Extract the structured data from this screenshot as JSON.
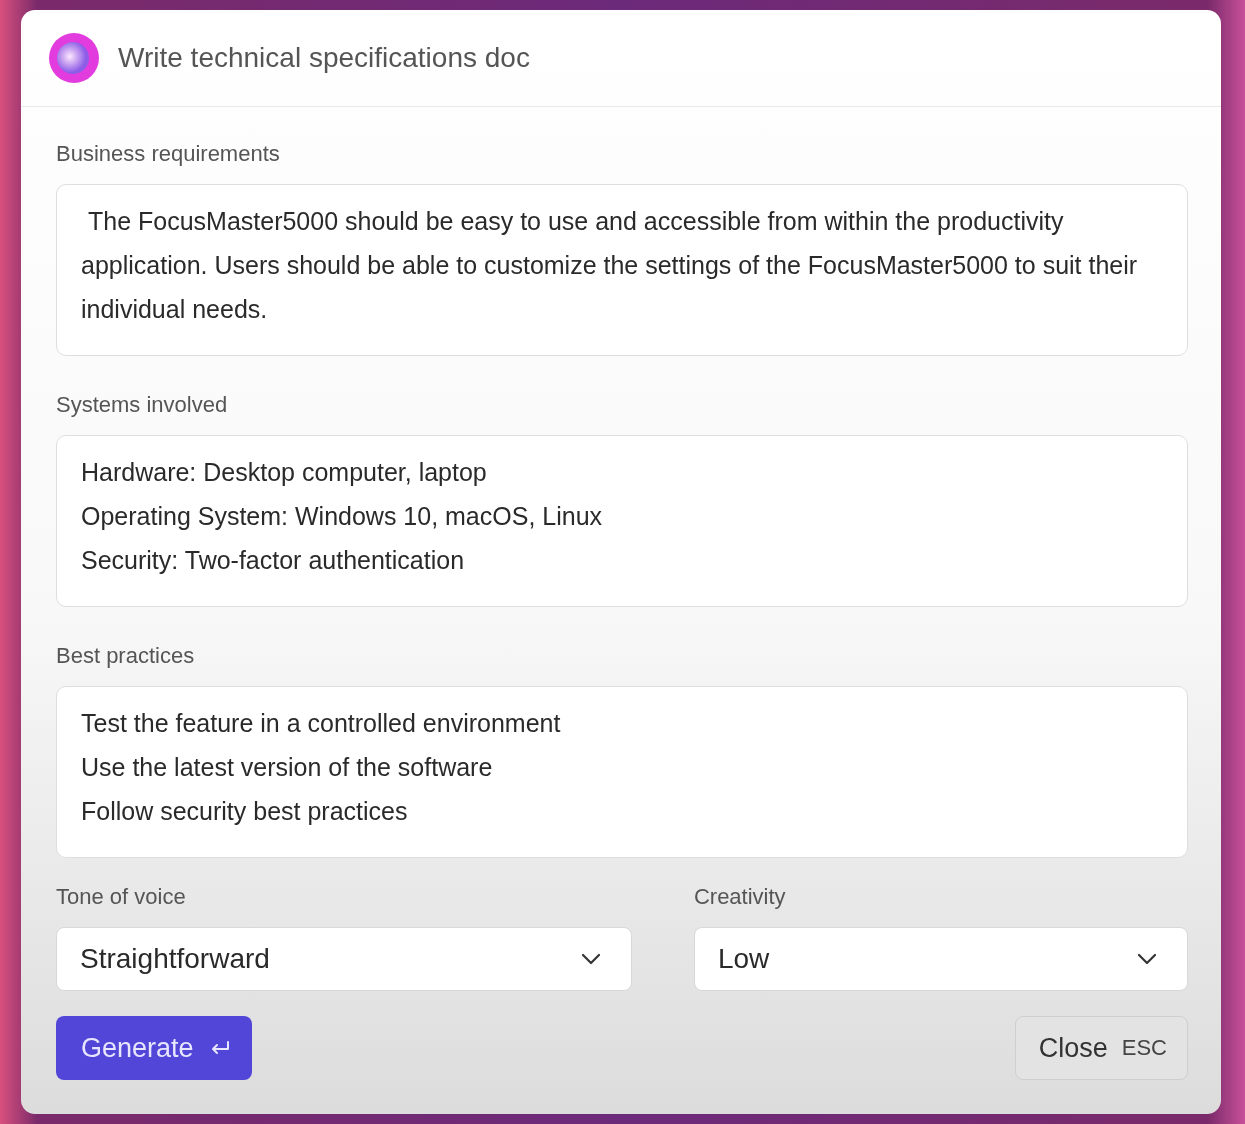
{
  "dialog": {
    "title": "Write technical specifications doc"
  },
  "fields": [
    {
      "label": "Business requirements",
      "value": " The FocusMaster5000 should be easy to use and accessible from within the productivity application. Users should be able to customize the settings of the FocusMaster5000 to suit their individual needs."
    },
    {
      "label": "Systems involved",
      "value": "Hardware: Desktop computer, laptop\nOperating System: Windows 10, macOS, Linux\nSecurity: Two-factor authentication"
    },
    {
      "label": "Best practices",
      "value": "Test the feature in a controlled environment\nUse the latest version of the software\nFollow security best practices"
    }
  ],
  "selects": [
    {
      "label": "Tone of voice",
      "value": "Straightforward"
    },
    {
      "label": "Creativity",
      "value": "Low"
    }
  ],
  "buttons": [
    {
      "kind": "primary",
      "label": "Generate"
    },
    {
      "kind": "secondary",
      "label": "Close",
      "shortcut": "ESC"
    }
  ]
}
